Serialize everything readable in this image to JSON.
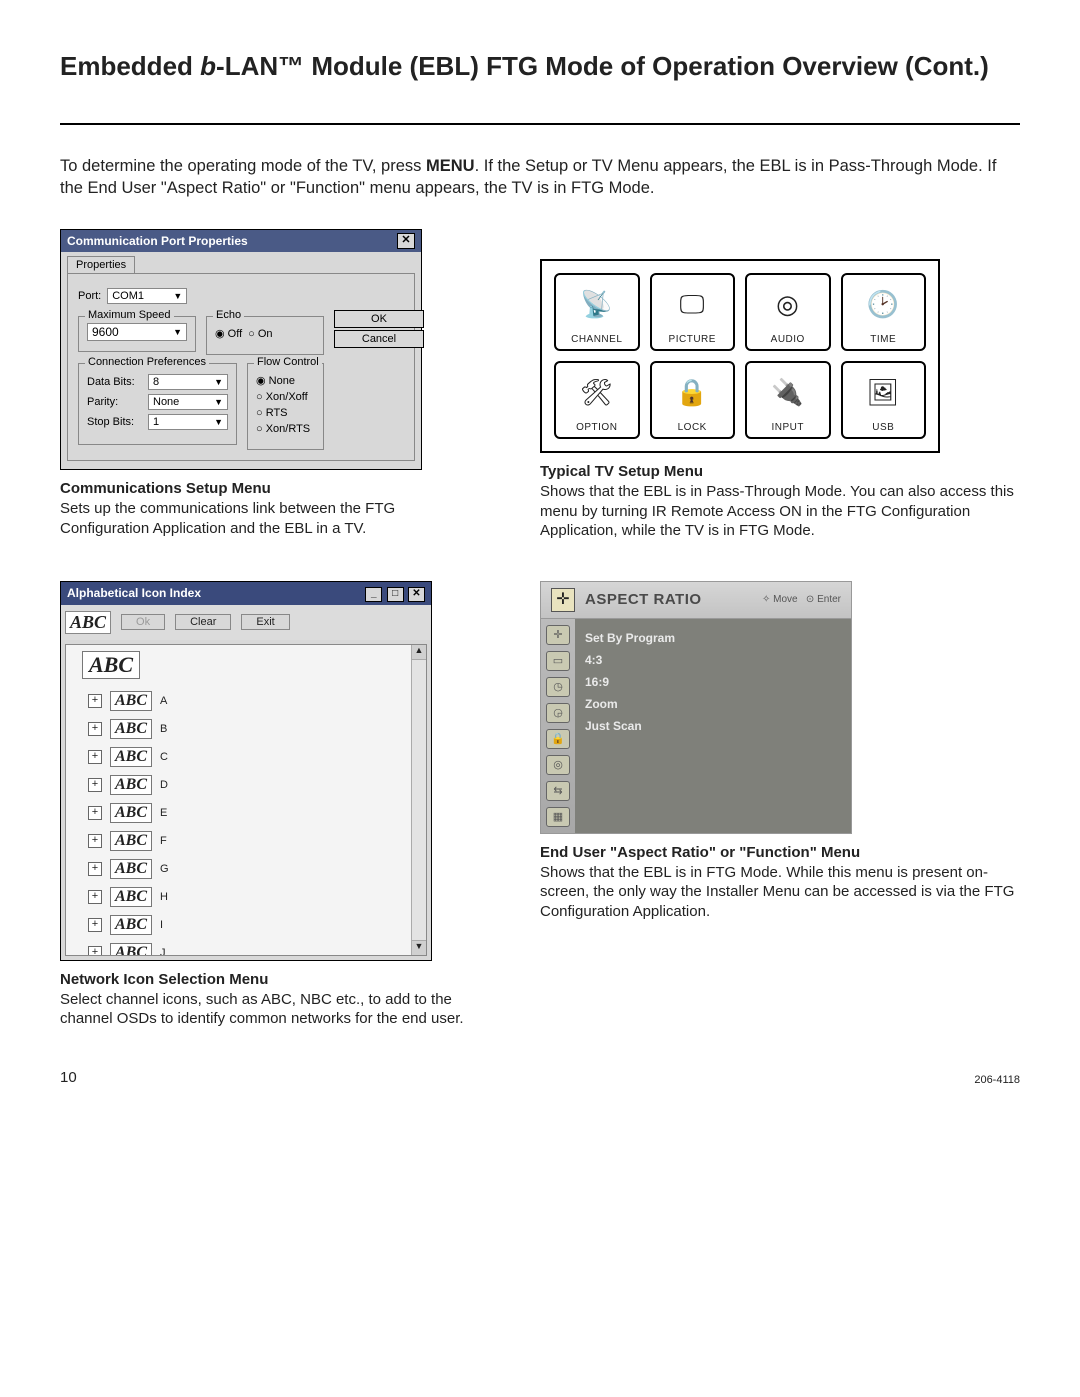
{
  "title_pre": "Embedded ",
  "title_italic": "b",
  "title_post": "-LAN™ Module (EBL) FTG Mode of Operation Overview (Cont.)",
  "intro_pre": "To determine the operating mode of the TV, press ",
  "intro_bold": "MENU",
  "intro_post": ". If the Setup or TV Menu appears, the EBL is in Pass-Through Mode. If the End User \"Aspect Ratio\" or \"Function\" menu appears, the TV is in FTG Mode.",
  "comm_dialog": {
    "title": "Communication Port Properties",
    "tab": "Properties",
    "port_label": "Port:",
    "port_value": "COM1",
    "maxspeed_legend": "Maximum Speed",
    "maxspeed_value": "9600",
    "echo_legend": "Echo",
    "echo_off": "Off",
    "echo_on": "On",
    "ok": "OK",
    "cancel": "Cancel",
    "connpref_legend": "Connection Preferences",
    "databits_label": "Data Bits:",
    "databits_value": "8",
    "parity_label": "Parity:",
    "parity_value": "None",
    "stopbits_label": "Stop Bits:",
    "stopbits_value": "1",
    "flow_legend": "Flow Control",
    "flow_none": "None",
    "flow_xon": "Xon/Xoff",
    "flow_rts": "RTS",
    "flow_xonrts": "Xon/RTS"
  },
  "comm_caption_title": "Communications Setup Menu",
  "comm_caption_text": "Sets up the communications link between the FTG Configuration Application and the EBL in a TV.",
  "tvmenu": {
    "cells": [
      {
        "label": "CHANNEL",
        "icon": "📡"
      },
      {
        "label": "PICTURE",
        "icon": "🖵"
      },
      {
        "label": "AUDIO",
        "icon": "◎"
      },
      {
        "label": "TIME",
        "icon": "🕑"
      },
      {
        "label": "OPTION",
        "icon": "🛠"
      },
      {
        "label": "LOCK",
        "icon": "🔒"
      },
      {
        "label": "INPUT",
        "icon": "🔌"
      },
      {
        "label": "USB",
        "icon": "🖼"
      }
    ]
  },
  "tvmenu_caption_title": "Typical TV Setup Menu",
  "tvmenu_caption_text": "Shows that the EBL is in Pass-Through Mode. You can also access this menu by turning IR Remote Access ON in the FTG Configuration Application, while the TV is in FTG Mode.",
  "iconwin": {
    "title": "Alphabetical Icon Index",
    "btn_ok": "Ok",
    "btn_clear": "Clear",
    "btn_exit": "Exit",
    "root": "ABC",
    "items": [
      {
        "logo": "ABC",
        "label": "A"
      },
      {
        "logo": "ABC",
        "label": "B"
      },
      {
        "logo": "ABC",
        "label": "C"
      },
      {
        "logo": "ABC",
        "label": "D"
      },
      {
        "logo": "ABC",
        "label": "E"
      },
      {
        "logo": "ABC",
        "label": "F"
      },
      {
        "logo": "ABC",
        "label": "G"
      },
      {
        "logo": "ABC",
        "label": "H"
      },
      {
        "logo": "ABC",
        "label": "I"
      },
      {
        "logo": "ABC",
        "label": "J"
      }
    ]
  },
  "iconwin_caption_title": "Network Icon Selection Menu",
  "iconwin_caption_text": "Select channel icons, such as ABC, NBC etc., to add to the channel OSDs to identify common networks for the end user.",
  "osd": {
    "title": "ASPECT RATIO",
    "hint_move": "Move",
    "hint_enter": "Enter",
    "options": [
      "Set By Program",
      "4:3",
      "16:9",
      "Zoom",
      "Just Scan"
    ]
  },
  "osd_caption_title": "End User \"Aspect Ratio\" or \"Function\" Menu",
  "osd_caption_text": "Shows that the EBL is in FTG Mode. While this menu is present on-screen, the only way the Installer Menu can be accessed is via the FTG Configuration Application.",
  "page_number": "10",
  "doc_id": "206-4118"
}
